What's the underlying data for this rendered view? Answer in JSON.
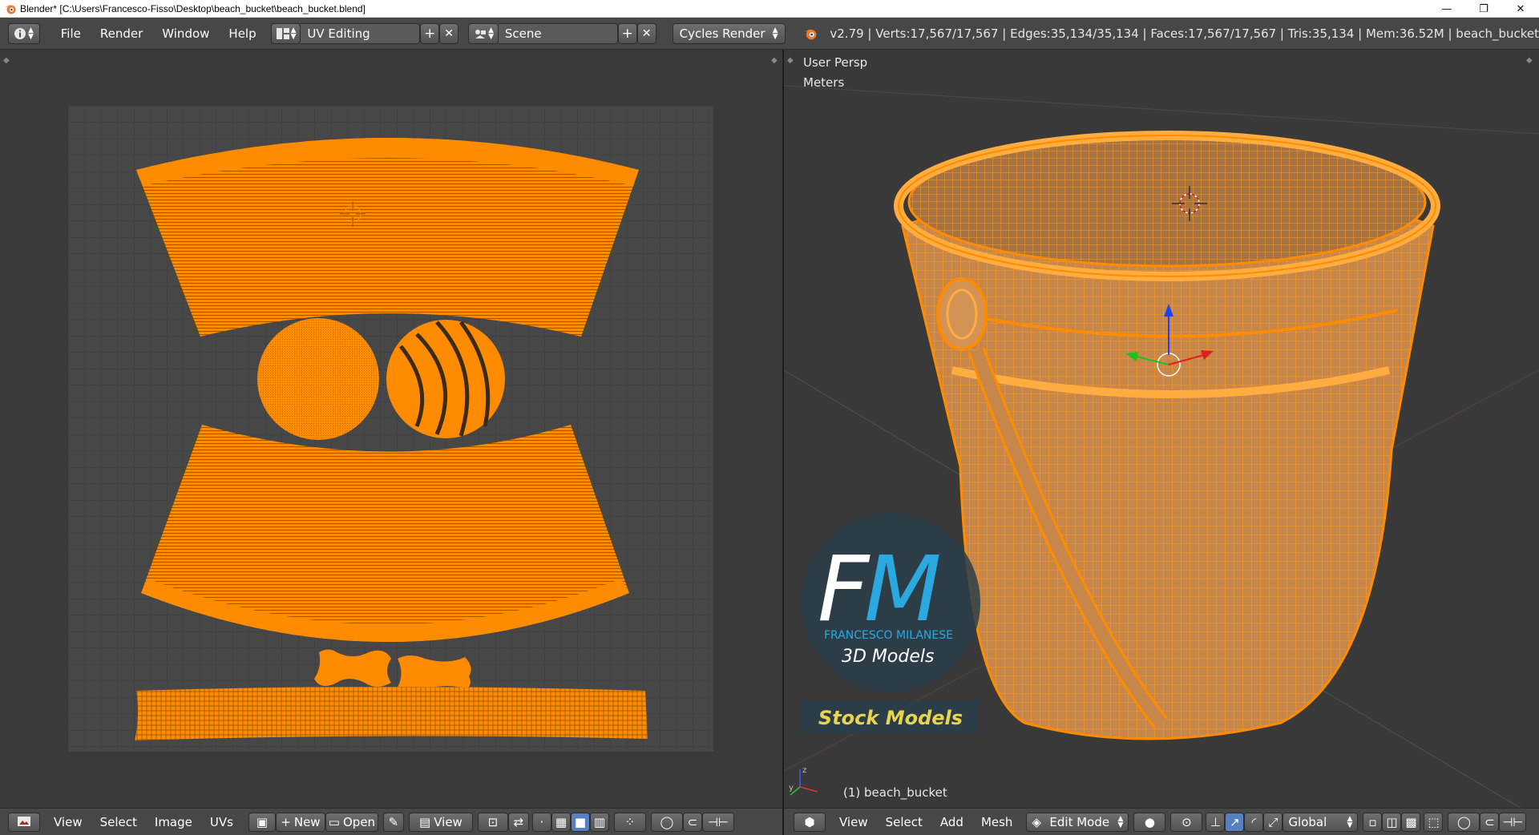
{
  "window": {
    "title": "Blender* [C:\\Users\\Francesco-Fisso\\Desktop\\beach_bucket\\beach_bucket.blend]",
    "minimize": "—",
    "restore": "❐",
    "close": "✕"
  },
  "info_header": {
    "menus": [
      "File",
      "Render",
      "Window",
      "Help"
    ],
    "screen_layout": "UV Editing",
    "scene": "Scene",
    "render_engine": "Cycles Render",
    "stats": "v2.79 | Verts:17,567/17,567 | Edges:35,134/35,134 | Faces:17,567/17,567 | Tris:35,134 | Mem:36.52M | beach_bucket"
  },
  "uv_editor": {
    "footer_menus": [
      "View",
      "Select",
      "Image",
      "UVs"
    ],
    "new_label": "New",
    "open_label": "Open",
    "view_label": "View"
  },
  "viewport": {
    "view_name": "User Persp",
    "units": "Meters",
    "object_label": "(1) beach_bucket",
    "footer_menus": [
      "View",
      "Select",
      "Add",
      "Mesh"
    ],
    "mode": "Edit Mode",
    "orientation": "Global",
    "watermark": {
      "initials_f": "F",
      "initials_m": "M",
      "name": "FRANCESCO MILANESE",
      "subtitle": "3D Models",
      "banner": "Stock Models"
    }
  },
  "colors": {
    "header_bg": "#474747",
    "editor_bg": "#3a3a3a",
    "uv_grid": "#4f4f4f",
    "mesh_orange": "#ff8c00",
    "watermark_blue": "#29a9e0",
    "banner_yellow": "#e8d44d"
  }
}
